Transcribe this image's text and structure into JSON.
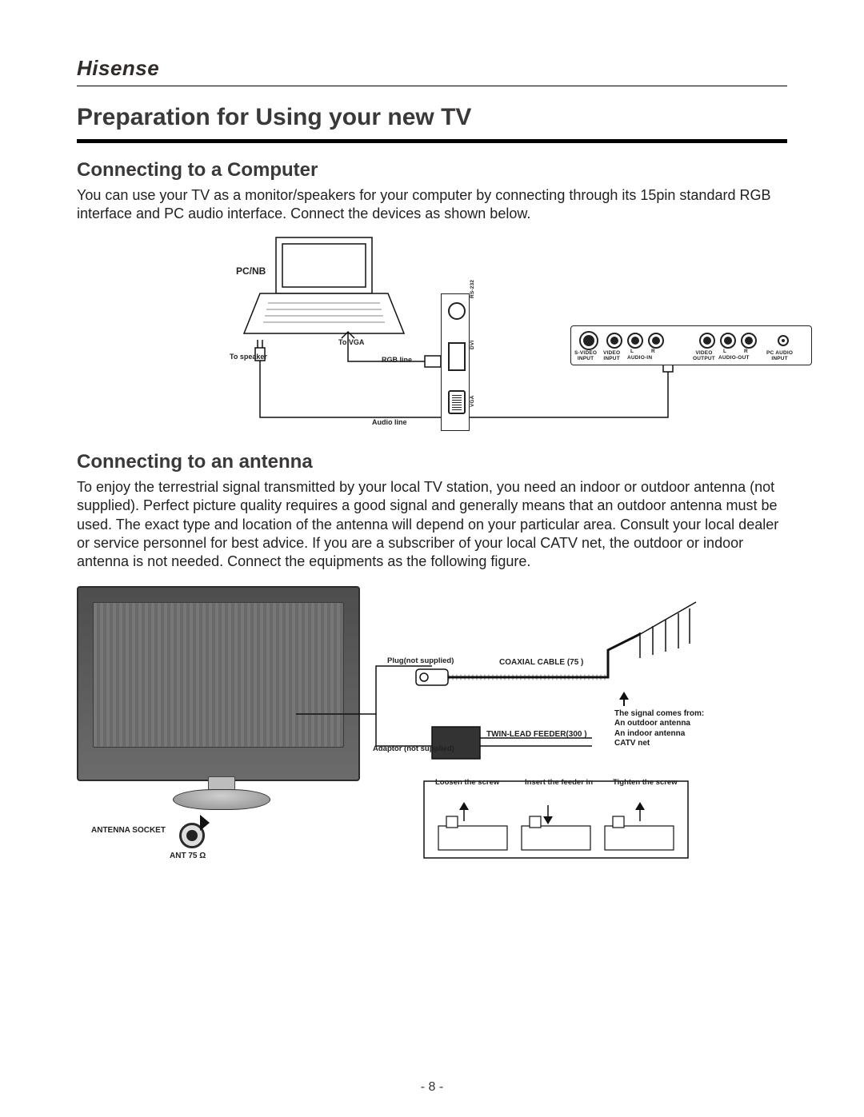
{
  "brand": "Hisense",
  "title": "Preparation for Using your new TV",
  "section1": {
    "heading": "Connecting to a  Computer",
    "body": "You can use your TV as a monitor/speakers for your computer by connecting through its 15pin standard RGB interface and PC audio interface. Connect the devices as shown below."
  },
  "fig1": {
    "pc_nb": "PC/NB",
    "to_speaker": "To speaker",
    "to_vga": "To VGA",
    "rgb_line": "RGB line",
    "audio_line": "Audio line",
    "side_ports": {
      "rs232": "RS-232",
      "dvi": "DVI",
      "vga": "VGA"
    },
    "rear_ports": {
      "svideo": "S-VIDEO\nINPUT",
      "video_in": "VIDEO\nINPUT",
      "audio_in_l": "L",
      "audio_in_r": "R",
      "audio_in": "AUDIO-IN",
      "video_out": "VIDEO\nOUTPUT",
      "audio_out_l": "L",
      "audio_out_r": "R",
      "audio_out": "AUDIO-OUT",
      "pc_audio": "PC AUDIO\nINPUT"
    }
  },
  "section2": {
    "heading": "Connecting to an antenna",
    "body": "To enjoy the terrestrial signal transmitted by your local TV station, you need an indoor or outdoor antenna (not supplied). Perfect picture quality requires a good signal and generally means that an outdoor antenna must be used. The exact type and location of the antenna will depend on your particular area. Consult  your local dealer or service personnel for best advice. If you are a subscriber of your local CATV net, the outdoor or indoor antenna is not needed. Connect the equipments as the following figure."
  },
  "fig2": {
    "antenna_socket": "ANTENNA SOCKET",
    "ant75": "ANT 75 Ω",
    "plug": "Plug(not supplied)",
    "coax": "COAXIAL CABLE (75    )",
    "twin": "TWIN-LEAD FEEDER(300    )",
    "adaptor": "Adaptor (not supplied)",
    "signal_title": "The signal comes from:",
    "signal_1": "An  outdoor antenna",
    "signal_2": "An  indoor antenna",
    "signal_3": "CATV  net",
    "step1": "Loosen the screw",
    "step2": "Insert the feeder in",
    "step3": "Tighten the screw"
  },
  "page_number": "- 8 -"
}
